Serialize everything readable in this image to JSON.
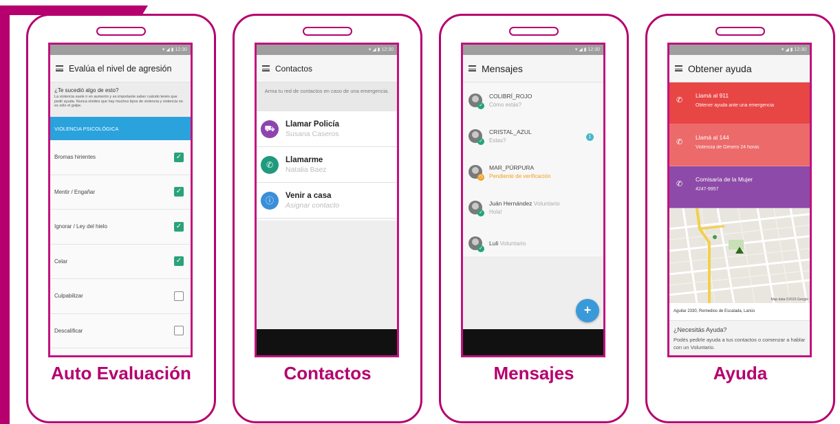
{
  "phones": [
    {
      "caption": "Auto Evaluación",
      "status_time": "12:30",
      "title": "Evalúa el nivel de agresión",
      "intro_question": "¿Te sucedió algo de esto?",
      "intro_text": "La violencia suele ir en aumento y es importante saber cuándo tenés que pedir ayuda. Nunca olvides que hay muchos tipos de violencia y violencia no es sólo el golpe.",
      "category": "VIOLENCIA PSICOLÓGICA",
      "items": [
        {
          "label": "Bromas hirientes",
          "checked": true
        },
        {
          "label": "Mentir / Engañar",
          "checked": true
        },
        {
          "label": "Ignorar / Ley del hielo",
          "checked": true
        },
        {
          "label": "Celar",
          "checked": true
        },
        {
          "label": "Culpabilizar",
          "checked": false
        },
        {
          "label": "Descalificar",
          "checked": false
        }
      ]
    },
    {
      "caption": "Contactos",
      "status_time": "12:30",
      "title": "Contactos",
      "hint": "Arma tu red de contactos en caso de una emergencia.",
      "contacts": [
        {
          "title": "Llamar Policía",
          "subtitle": "Susana Caseros",
          "icon": "car-icon",
          "color": "#8e44ad"
        },
        {
          "title": "Llamarme",
          "subtitle": "Natalia Baez",
          "icon": "phone-icon",
          "color": "#1f9a7d"
        },
        {
          "title": "Venir a casa",
          "subtitle": "Asignar contacto",
          "icon": "home-icon",
          "color": "#3a8fd9"
        }
      ]
    },
    {
      "caption": "Mensajes",
      "status_time": "12:30",
      "title": "Mensajes",
      "messages": [
        {
          "name": "COLIBRÍ_ROJO",
          "extra": "",
          "preview": "Cómo estás?",
          "state": "verified",
          "unread": ""
        },
        {
          "name": "CRISTAL_AZUL",
          "extra": "",
          "preview": "Estas?",
          "state": "verified",
          "unread": "1"
        },
        {
          "name": "MAR_PÚRPURA",
          "extra": "",
          "preview": "Pendiente de verificación",
          "state": "pending",
          "unread": ""
        },
        {
          "name": "Juán Hernández",
          "extra": "Voluntario",
          "preview": "Hola!",
          "state": "verified",
          "unread": ""
        },
        {
          "name": "Luli",
          "extra": "Voluntario",
          "preview": "",
          "state": "verified",
          "unread": ""
        }
      ],
      "fab_label": "+"
    },
    {
      "caption": "Ayuda",
      "status_time": "12:30",
      "title": "Obtener ayuda",
      "cards": [
        {
          "title": "Llamá al 911",
          "subtitle": "Obtener ayuda ante una emergencia",
          "color": "#e84545"
        },
        {
          "title": "Llamá al 144",
          "subtitle": "Violencia de Género 24 horas",
          "color": "#ec6a6a"
        },
        {
          "title": "Comisaría de la Mujer",
          "subtitle": "4247-9957",
          "color": "#8d4aa8"
        }
      ],
      "map_attribution": "Map data ©2015 Google",
      "address": "Aguilar 2330, Remedios de Escalada, Lanús",
      "need_help_title": "¿Necesitás Ayuda?",
      "need_help_text": "Podés pedirle ayuda a tus contactos o comenzar a hablar con un Voluntario."
    }
  ]
}
